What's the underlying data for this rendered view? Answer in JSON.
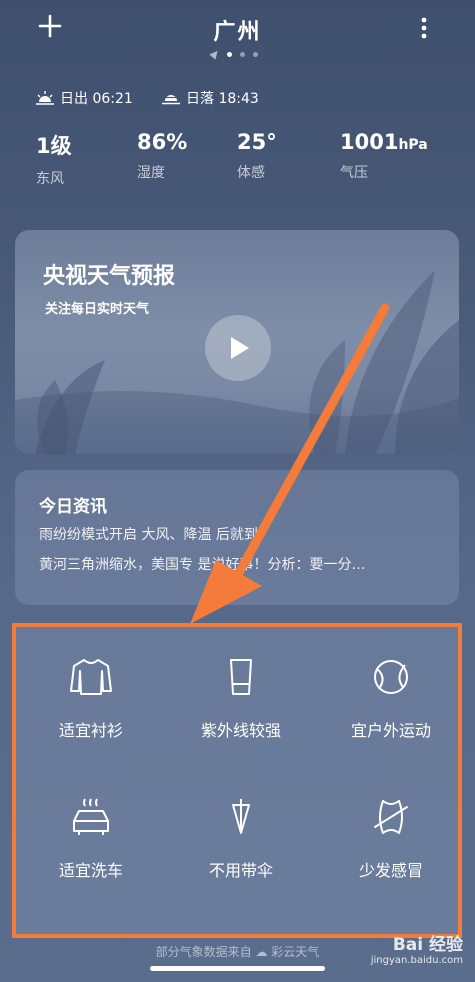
{
  "header": {
    "add_icon": "plus-icon",
    "city": "广州",
    "menu_icon": "more-vertical-icon"
  },
  "sun": {
    "sunrise": "日出 06:21",
    "sunset": "日落 18:43"
  },
  "stats": [
    {
      "value": "1级",
      "unit": "",
      "label": "东风"
    },
    {
      "value": "86%",
      "unit": "",
      "label": "湿度"
    },
    {
      "value": "25°",
      "unit": "",
      "label": "体感"
    },
    {
      "value": "1001",
      "unit": "hPa",
      "label": "气压"
    }
  ],
  "video": {
    "title": "央视天气预报",
    "subtitle": "关注每日实时天气"
  },
  "news": {
    "title": "今日资讯",
    "lines": [
      "雨纷纷模式开启 大风、降温 后就到",
      "黄河三角洲缩水，美国专 是说好事！分析：要一分…"
    ]
  },
  "life": [
    {
      "label": "适宜衬衫",
      "icon": "shirt-icon"
    },
    {
      "label": "紫外线较强",
      "icon": "cup-icon"
    },
    {
      "label": "宜户外运动",
      "icon": "ball-icon"
    },
    {
      "label": "适宜洗车",
      "icon": "car-wash-icon"
    },
    {
      "label": "不用带伞",
      "icon": "umbrella-icon"
    },
    {
      "label": "少发感冒",
      "icon": "cold-icon"
    }
  ],
  "footer": {
    "source": "部分气象数据来自 ☁ 彩云天气"
  },
  "watermark": {
    "main": "Bai 经验",
    "sub": "jingyan.baidu.com"
  },
  "colors": {
    "highlight": "#f47b3a",
    "bg_top": "#3f4f6e",
    "bg_bottom": "#5a6d8d"
  }
}
